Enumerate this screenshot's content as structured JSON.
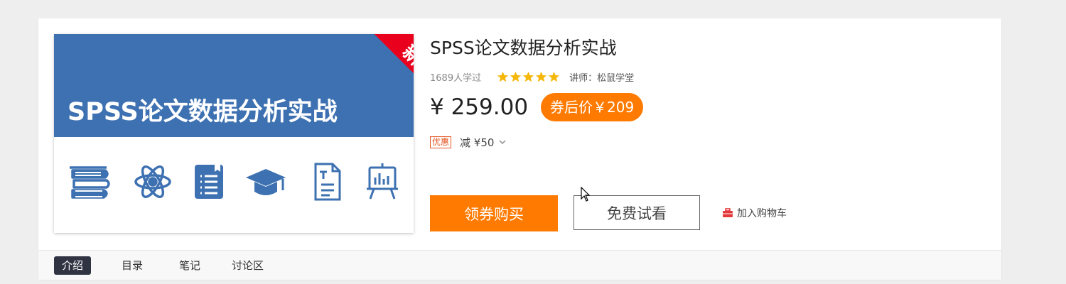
{
  "course": {
    "cover": {
      "title": "SPSS论文数据分析实战",
      "ribbon": "新课",
      "band_color": "#3d71b1",
      "ribbon_color": "#e8001c",
      "icons": [
        "books-icon",
        "atom-icon",
        "notebook-icon",
        "graduation-cap-icon",
        "document-icon",
        "chart-board-icon"
      ]
    },
    "title": "SPSS论文数据分析实战",
    "learners": "1689人学过",
    "rating": 5,
    "teacher": "讲师：松鼠学堂",
    "price": "¥ 259.00",
    "coupon_price": "券后价￥209",
    "discount_tag": "优惠",
    "discount_text": "减 ¥50",
    "accent_color": "#ff7a00"
  },
  "actions": {
    "buy_label": "领券购买",
    "trial_label": "免费试看",
    "cart_label": "加入购物车"
  },
  "tabs": [
    {
      "label": "介绍",
      "active": true
    },
    {
      "label": "目录",
      "active": false
    },
    {
      "label": "笔记",
      "active": false
    },
    {
      "label": "讨论区",
      "active": false
    }
  ]
}
